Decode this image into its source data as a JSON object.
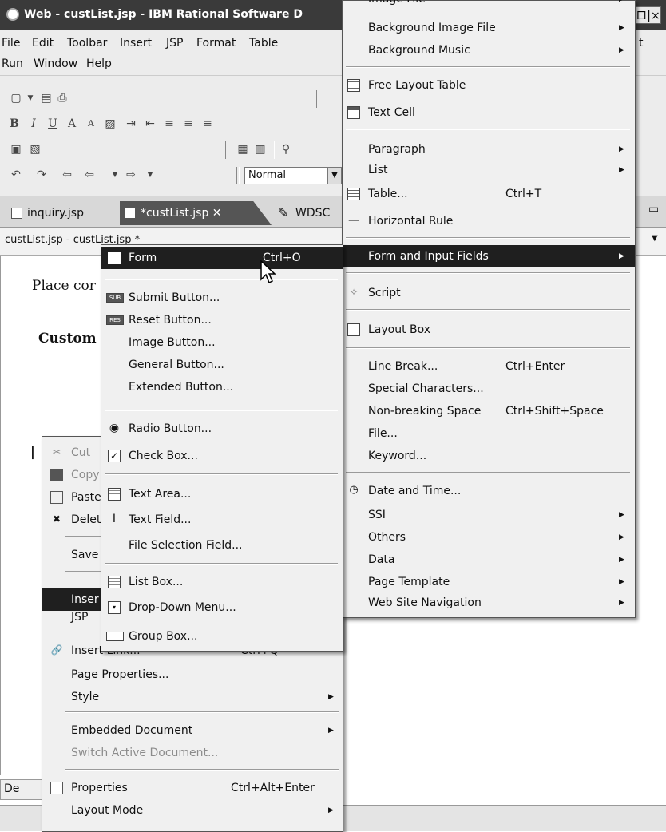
{
  "window": {
    "title": "Web - custList.jsp - IBM Rational Software D",
    "controls": "_ロ|×"
  },
  "menubar": {
    "row1": [
      "File",
      "Edit",
      "Toolbar",
      "Insert",
      "JSP",
      "Format",
      "Table"
    ],
    "row2": [
      "Run",
      "Window",
      "Help"
    ],
    "project_fragment": "t"
  },
  "toolbar": {
    "paragraph_style": "Normal"
  },
  "editor": {
    "tabs": [
      {
        "label": "inquiry.jsp"
      },
      {
        "label": "*custList.jsp ✕"
      },
      {
        "label": "WDSC"
      }
    ],
    "breadcrumb": "custList.jsp - custList.jsp *",
    "body_text": "Place cor",
    "box_text": "Custom"
  },
  "bottom": {
    "tab_fragment": "De"
  },
  "context_menu": {
    "items": [
      {
        "label": "Cut",
        "state": "disabled"
      },
      {
        "label": "Copy",
        "state": "disabled"
      },
      {
        "label": "Paste"
      },
      {
        "label": "Delet"
      },
      {
        "label": "Save"
      },
      {
        "label": "Inser",
        "state": "highlighted"
      },
      {
        "label": "JSP"
      },
      {
        "label": "Insert Link...",
        "shortcut": "Ctrl+Q",
        "state": "partial"
      },
      {
        "label": "Page Properties..."
      },
      {
        "label": "Style",
        "submenu": true
      },
      {
        "label": "Embedded Document",
        "submenu": true
      },
      {
        "label": "Switch Active Document...",
        "state": "disabled"
      },
      {
        "label": "Properties",
        "shortcut": "Ctrl+Alt+Enter"
      },
      {
        "label": "Layout Mode",
        "submenu": true
      }
    ]
  },
  "insert_menu": {
    "items": [
      {
        "label": "Image File",
        "submenu": true,
        "state": "clipped"
      },
      {
        "label": "Background Image File",
        "submenu": true
      },
      {
        "label": "Background Music",
        "submenu": true
      },
      {
        "label": "Free Layout Table"
      },
      {
        "label": "Text Cell"
      },
      {
        "label": "Paragraph",
        "submenu": true
      },
      {
        "label": "List",
        "submenu": true
      },
      {
        "label": "Table...",
        "shortcut": "Ctrl+T"
      },
      {
        "label": "Horizontal Rule"
      },
      {
        "label": "Form and Input Fields",
        "submenu": true,
        "state": "highlighted"
      },
      {
        "label": "Script"
      },
      {
        "label": "Layout Box"
      },
      {
        "label": "Line Break...",
        "shortcut": "Ctrl+Enter"
      },
      {
        "label": "Special Characters..."
      },
      {
        "label": "Non-breaking Space",
        "shortcut": "Ctrl+Shift+Space"
      },
      {
        "label": "File..."
      },
      {
        "label": "Keyword..."
      },
      {
        "label": "Date and Time..."
      },
      {
        "label": "SSI",
        "submenu": true
      },
      {
        "label": "Others",
        "submenu": true
      },
      {
        "label": "Data",
        "submenu": true
      },
      {
        "label": "Page Template",
        "submenu": true
      },
      {
        "label": "Web Site Navigation",
        "submenu": true
      }
    ]
  },
  "form_menu": {
    "items": [
      {
        "label": "Form",
        "shortcut": "Ctrl+O",
        "state": "highlighted"
      },
      {
        "label": "Submit Button...",
        "icon_text": "SUB"
      },
      {
        "label": "Reset Button...",
        "icon_text": "RES"
      },
      {
        "label": "Image Button..."
      },
      {
        "label": "General Button..."
      },
      {
        "label": "Extended Button..."
      },
      {
        "label": "Radio Button..."
      },
      {
        "label": "Check Box..."
      },
      {
        "label": "Text Area..."
      },
      {
        "label": "Text Field..."
      },
      {
        "label": "File Selection Field..."
      },
      {
        "label": "List Box..."
      },
      {
        "label": "Drop-Down Menu..."
      },
      {
        "label": "Group Box..."
      }
    ]
  }
}
